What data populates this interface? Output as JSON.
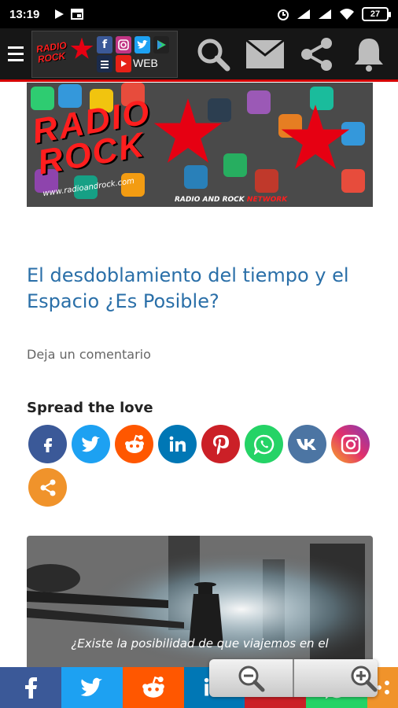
{
  "status": {
    "time": "13:19",
    "battery": "27"
  },
  "app_bar": {
    "logo_web": "WEB",
    "logo_text_top": "RADIO",
    "logo_text_bottom": "ROCK"
  },
  "banner": {
    "line1": "RADIO",
    "line2": "ROCK",
    "url": "www.radioandrock.com",
    "network_a": "RADIO AND ROCK ",
    "network_b": "NETWORK"
  },
  "post": {
    "title": "El desdoblamiento del tiempo y el Espacio ¿Es Posible?",
    "comment_link": "Deja un comentario",
    "spread_title": "Spread the love",
    "image_caption": "¿Existe la posibilidad de que viajemos en el"
  },
  "share_buttons": [
    {
      "name": "facebook",
      "color": "#3b5998"
    },
    {
      "name": "twitter",
      "color": "#1da1f2"
    },
    {
      "name": "reddit",
      "color": "#ff5700"
    },
    {
      "name": "linkedin",
      "color": "#0077b5"
    },
    {
      "name": "pinterest",
      "color": "#cb2027"
    },
    {
      "name": "whatsapp",
      "color": "#25d366"
    },
    {
      "name": "vk",
      "color": "#4c75a3"
    },
    {
      "name": "instagram",
      "color": "#c13584"
    },
    {
      "name": "share",
      "color": "#f0932b"
    }
  ],
  "bottom_bar": [
    {
      "name": "facebook",
      "color": "#3b5998"
    },
    {
      "name": "twitter",
      "color": "#1da1f2"
    },
    {
      "name": "reddit",
      "color": "#ff5700"
    },
    {
      "name": "linkedin",
      "color": "#0077b5"
    },
    {
      "name": "pinterest",
      "color": "#cb2027"
    },
    {
      "name": "whatsapp",
      "color": "#25d366"
    },
    {
      "name": "share",
      "color": "#f0932b"
    }
  ],
  "icons": {
    "menu": "hamburger-icon",
    "search": "search-icon",
    "mail": "mail-icon",
    "share": "share-icon",
    "bell": "bell-icon",
    "zoom_out": "zoom-out-icon",
    "zoom_in": "zoom-in-icon"
  }
}
